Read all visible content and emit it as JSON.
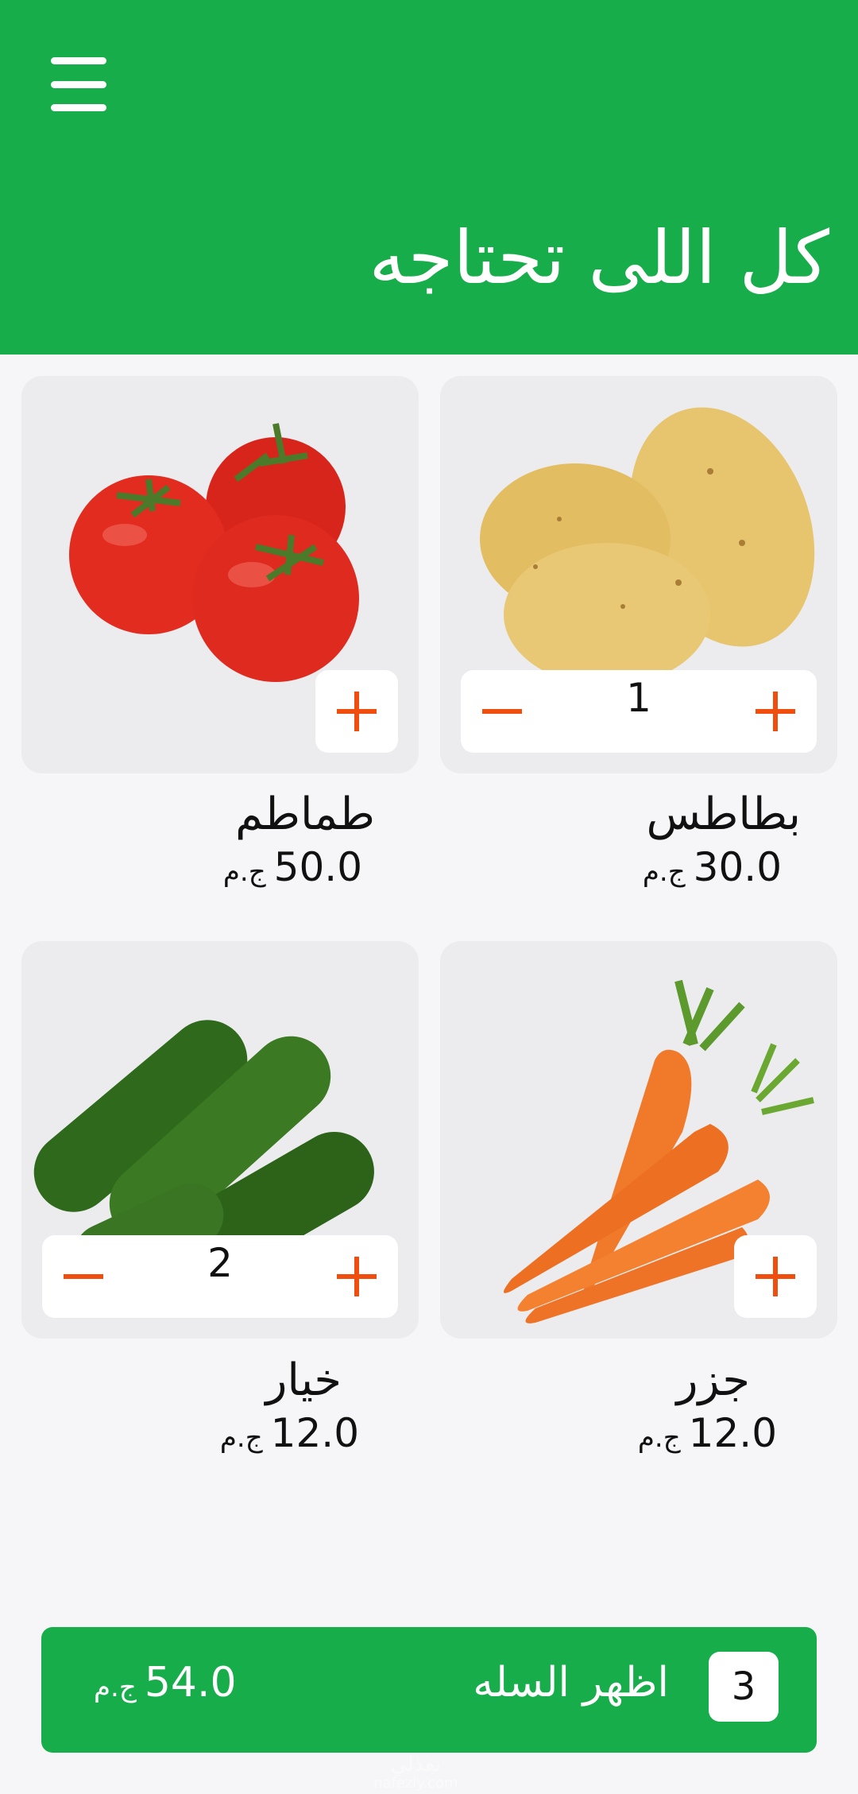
{
  "header": {
    "title": "كل اللى تحتاجه",
    "menu_icon": "hamburger-menu-icon",
    "background": "#17ad4b"
  },
  "products": [
    {
      "name": "بطاطس",
      "price": "30.0",
      "currency": "ج.م",
      "quantity": "1",
      "image": "potato"
    },
    {
      "name": "طماطم",
      "price": "50.0",
      "currency": "ج.م",
      "image": "tomato"
    },
    {
      "name": "جزر",
      "price": "12.0",
      "currency": "ج.م",
      "image": "carrot"
    },
    {
      "name": "خيار",
      "price": "12.0",
      "currency": "ج.م",
      "quantity": "2",
      "image": "cucumber"
    }
  ],
  "cart": {
    "count": "3",
    "label": "اظهر السله",
    "total": "54.0",
    "currency": "ج.م"
  },
  "watermark": {
    "arabic": "نفذلي",
    "latin": "nafezly.com"
  },
  "colors": {
    "accent": "#17ad4b",
    "action": "#f04e0f"
  }
}
